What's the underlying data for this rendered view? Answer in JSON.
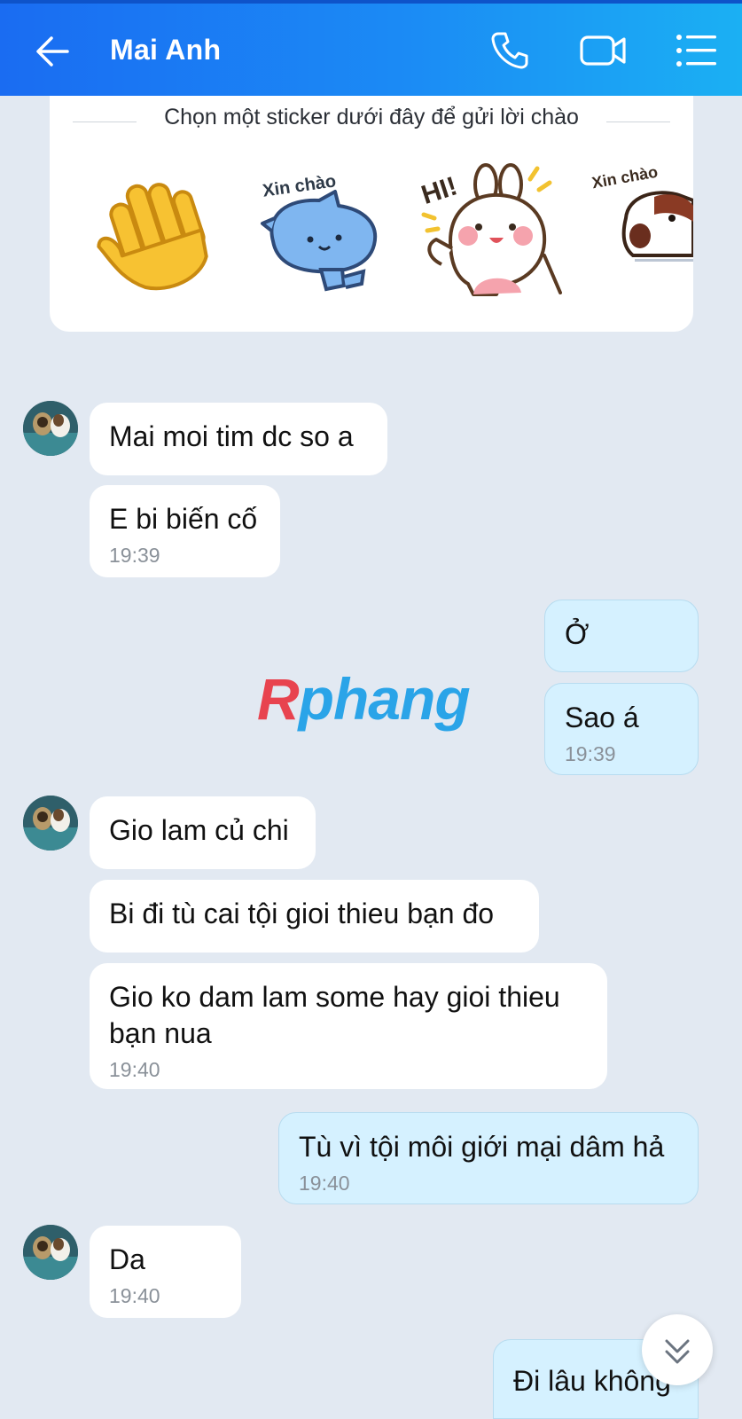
{
  "header": {
    "title": "Mai Anh",
    "back_icon": "arrow-left-icon",
    "call_icon": "phone-icon",
    "video_icon": "video-camera-icon",
    "menu_icon": "list-menu-icon",
    "colors": {
      "gradient_start": "#1a6cf2",
      "gradient_end": "#1bb0f3"
    }
  },
  "sticker_panel": {
    "caption": "Chọn một sticker dưới đây để gửi lời chào",
    "stickers": [
      {
        "name": "waving-hand-sticker"
      },
      {
        "name": "blue-cat-sticker",
        "text": "Xin chào"
      },
      {
        "name": "bunny-hi-sticker",
        "text": "HI!"
      },
      {
        "name": "dog-sticker",
        "text": "Xin chào"
      }
    ]
  },
  "watermark": {
    "first": "R",
    "rest": "phang"
  },
  "messages": [
    {
      "sender": "them",
      "text": "Mai moi tim dc so a"
    },
    {
      "sender": "them",
      "text": "E bi biến cố",
      "time": "19:39"
    },
    {
      "sender": "me",
      "text": "Ở"
    },
    {
      "sender": "me",
      "text": "Sao á",
      "time": "19:39"
    },
    {
      "sender": "them",
      "text": "Gio lam củ chi"
    },
    {
      "sender": "them",
      "text": "Bi đi tù cai tội gioi thieu bạn đo"
    },
    {
      "sender": "them",
      "text": "Gio ko dam lam some hay gioi thieu bạn nua",
      "time": "19:40"
    },
    {
      "sender": "me",
      "text": "Tù vì tội môi giới mại dâm hả",
      "time": "19:40"
    },
    {
      "sender": "them",
      "text": "Da",
      "time": "19:40"
    },
    {
      "sender": "me",
      "text": "Đi lâu không"
    }
  ],
  "scroll_down_icon": "chevron-double-down-icon"
}
